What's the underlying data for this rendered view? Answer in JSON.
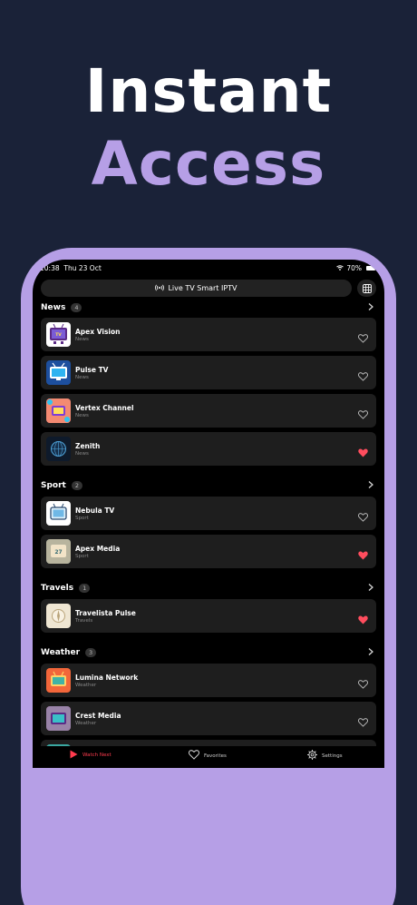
{
  "hero": {
    "line1": "Instant",
    "line2": "Access"
  },
  "status": {
    "time": "10:38",
    "date": "Thu 23 Oct",
    "battery": "70%"
  },
  "header": {
    "title": "Live TV Smart IPTV"
  },
  "sections": [
    {
      "title": "News",
      "count": "4",
      "items": [
        {
          "name": "Apex Vision",
          "category": "News",
          "favorite": false,
          "icon": "retro-tv-icon"
        },
        {
          "name": "Pulse TV",
          "category": "News",
          "favorite": false,
          "icon": "tv-screen-icon"
        },
        {
          "name": "Vertex Channel",
          "category": "News",
          "favorite": false,
          "icon": "colorful-tv-icon"
        },
        {
          "name": "Zenith",
          "category": "News",
          "favorite": true,
          "icon": "globe-tech-icon"
        }
      ]
    },
    {
      "title": "Sport",
      "count": "2",
      "items": [
        {
          "name": "Nebula TV",
          "category": "Sport",
          "favorite": false,
          "icon": "tv-sketch-icon"
        },
        {
          "name": "Apex Media",
          "category": "Sport",
          "favorite": true,
          "icon": "tv-27-icon"
        }
      ]
    },
    {
      "title": "Travels",
      "count": "1",
      "items": [
        {
          "name": "Travelista Pulse",
          "category": "Travels",
          "favorite": true,
          "icon": "compass-icon"
        }
      ]
    },
    {
      "title": "Weather",
      "count": "3",
      "items": [
        {
          "name": "Lumina Network",
          "category": "Weather",
          "favorite": false,
          "icon": "orange-tv-icon"
        },
        {
          "name": "Crest Media",
          "category": "Weather",
          "favorite": false,
          "icon": "pink-tv-icon"
        }
      ]
    }
  ],
  "tabs": [
    {
      "label": "Watch Next",
      "active": true
    },
    {
      "label": "Favorites",
      "active": false
    },
    {
      "label": "Settings",
      "active": false
    }
  ],
  "colors": {
    "background": "#1a2238",
    "accent": "#b69fe6",
    "active_tab": "#ff3b4e",
    "heart": "#ff4d5e"
  }
}
